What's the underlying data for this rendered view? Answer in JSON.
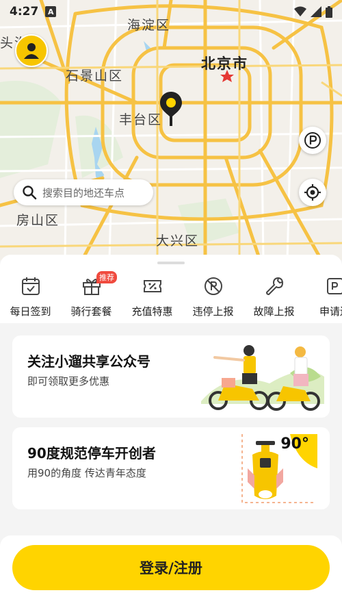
{
  "status_bar": {
    "time": "4:27",
    "notif_icon_letter": "A"
  },
  "map": {
    "labels": {
      "haidian": "海淀区",
      "beijing": "北京市",
      "shijingshan": "石景山区",
      "fengtai": "丰台区",
      "fangshan": "房山区",
      "daxing": "大兴区",
      "toutouedge": "头沟"
    },
    "road_color": "#f6c244",
    "minor_road_color": "#ffffff",
    "water_color": "#a8d5f0",
    "green_color": "#d9ecd0"
  },
  "search": {
    "placeholder": "搜索目的地还车点"
  },
  "services": [
    {
      "label": "每日签到",
      "icon": "calendar-check-icon"
    },
    {
      "label": "骑行套餐",
      "icon": "gift-icon",
      "badge": "推荐"
    },
    {
      "label": "充值特惠",
      "icon": "discount-ticket-icon"
    },
    {
      "label": "违停上报",
      "icon": "no-parking-icon"
    },
    {
      "label": "故障上报",
      "icon": "wrench-icon"
    },
    {
      "label": "申请还",
      "icon": "apply-icon"
    }
  ],
  "cards": [
    {
      "title": "关注小遛共享公众号",
      "subtitle": "即可领取更多优惠"
    },
    {
      "title": "90度规范停车开创者",
      "subtitle": "用90的角度 传达青年态度",
      "badge": "90°"
    }
  ],
  "login": {
    "label": "登录/注册"
  },
  "colors": {
    "brand": "#ffd400",
    "badge_red": "#f04a3e"
  }
}
